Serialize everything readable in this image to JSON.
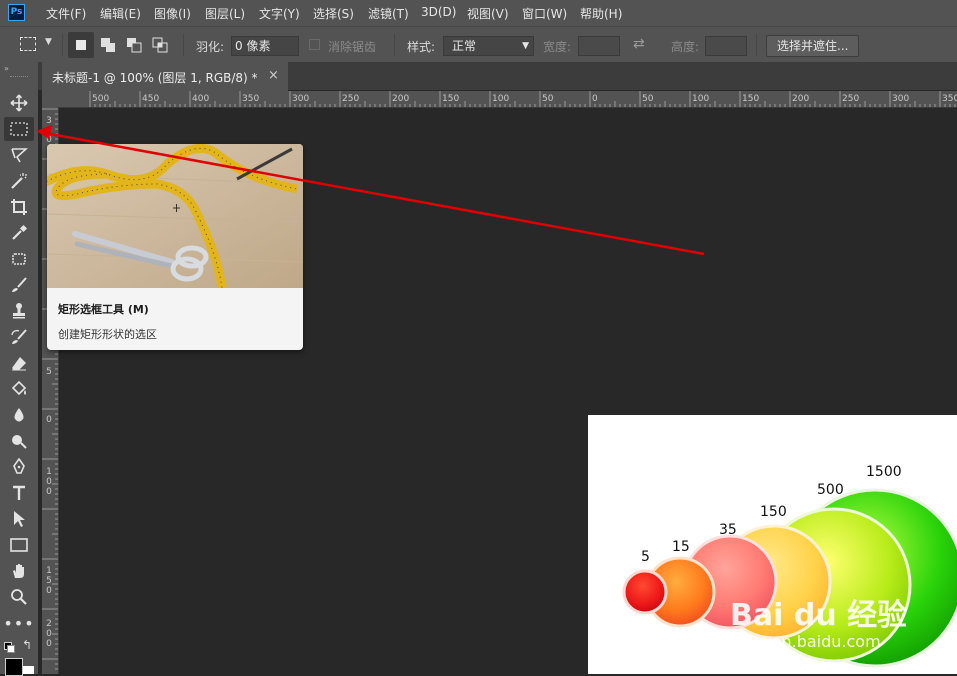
{
  "app": {
    "logo": "Ps"
  },
  "menu": [
    "文件(F)",
    "编辑(E)",
    "图像(I)",
    "图层(L)",
    "文字(Y)",
    "选择(S)",
    "滤镜(T)",
    "3D(D)",
    "视图(V)",
    "窗口(W)",
    "帮助(H)"
  ],
  "options": {
    "feather_label": "羽化:",
    "feather_value": "0 像素",
    "antialias_label": "消除锯齿",
    "style_label": "样式:",
    "style_value": "正常",
    "width_label": "宽度:",
    "height_label": "高度:",
    "select_mask_button": "选择并遮住..."
  },
  "document": {
    "tab_title": "未标题-1 @ 100% (图层 1, RGB/8) *",
    "close_glyph": "×"
  },
  "ruler": {
    "h_labels": [
      "500",
      "450",
      "400",
      "350",
      "300",
      "250",
      "200",
      "150",
      "100",
      "50",
      "0",
      "50",
      "100",
      "150",
      "200",
      "250",
      "300",
      "350"
    ],
    "v_labels": [
      "3",
      "0",
      "5",
      "0",
      "1 0 0",
      "1 5 0",
      "2 0 0",
      "2 5 0"
    ]
  },
  "tooltip": {
    "title": "矩形选框工具 (M)",
    "description": "创建矩形形状的选区"
  },
  "image_panel": {
    "labels": [
      "5",
      "15",
      "35",
      "150",
      "500",
      "1500"
    ]
  },
  "watermark": {
    "brand": "Bai du 经验",
    "url": "jingyan.baidu.com"
  },
  "colors": {
    "arrow": "#e00000",
    "accent": "#31a8ff",
    "ui_bg": "#535353",
    "canvas_bg": "#282828"
  },
  "tools": [
    "move-tool-icon",
    "rectangular-marquee-tool-icon",
    "lasso-tool-icon",
    "magic-wand-tool-icon",
    "crop-tool-icon",
    "eyedropper-tool-icon",
    "healing-brush-tool-icon",
    "brush-tool-icon",
    "clone-stamp-tool-icon",
    "history-brush-tool-icon",
    "eraser-tool-icon",
    "paint-bucket-tool-icon",
    "blur-tool-icon",
    "dodge-tool-icon",
    "pen-tool-icon",
    "type-tool-icon",
    "path-selection-tool-icon",
    "rectangle-tool-icon",
    "hand-tool-icon",
    "zoom-tool-icon",
    "more-tools-icon"
  ]
}
